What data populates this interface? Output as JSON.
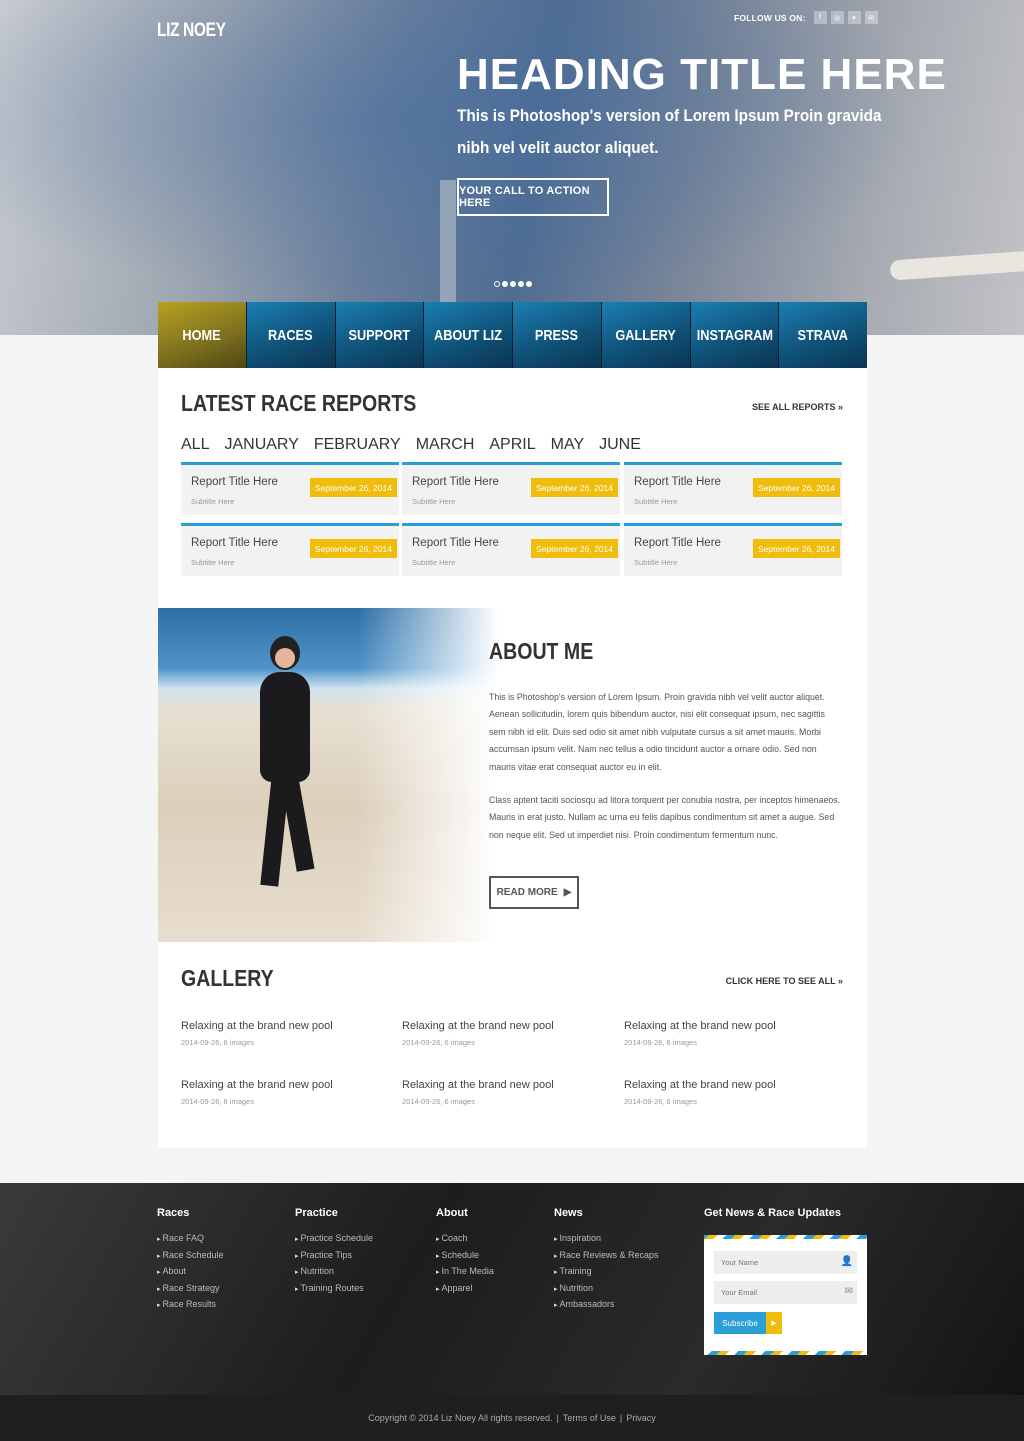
{
  "header": {
    "logo": "LIZ NOEY",
    "follow_label": "FOLLOW US ON:",
    "social": [
      {
        "icon": "facebook-icon",
        "glyph": "f"
      },
      {
        "icon": "instagram-icon",
        "glyph": "◎"
      },
      {
        "icon": "twitter-icon",
        "glyph": "▾"
      },
      {
        "icon": "email-icon",
        "glyph": "✉"
      }
    ]
  },
  "hero": {
    "title": "HEADING TITLE HERE",
    "subtitle": "This is Photoshop's version of Lorem Ipsum Proin gravida nibh vel velit auctor aliquet.",
    "cta": "YOUR CALL TO ACTION HERE",
    "slides_total": 5,
    "slide_active": 1
  },
  "nav": [
    "HOME",
    "RACES",
    "SUPPORT",
    "ABOUT LIZ",
    "PRESS",
    "GALLERY",
    "INSTAGRAM",
    "STRAVA"
  ],
  "reports": {
    "title": "LATEST RACE REPORTS",
    "see_all": "SEE ALL REPORTS »",
    "months": [
      "ALL",
      "JANUARY",
      "FEBRUARY",
      "MARCH",
      "APRIL",
      "MAY",
      "JUNE"
    ],
    "items": [
      {
        "title": "Report Title Here",
        "subtitle": "Subtitle Here",
        "date": "September 26, 2014"
      },
      {
        "title": "Report Title Here",
        "subtitle": "Subtitle Here",
        "date": "September 26, 2014"
      },
      {
        "title": "Report Title Here",
        "subtitle": "Subtitle Here",
        "date": "September 26, 2014"
      },
      {
        "title": "Report Title Here",
        "subtitle": "Subtitle Here",
        "date": "September 26, 2014"
      },
      {
        "title": "Report Title Here",
        "subtitle": "Subtitle Here",
        "date": "September 26, 2014"
      },
      {
        "title": "Report Title Here",
        "subtitle": "Subtitle Here",
        "date": "September 26, 2014"
      }
    ]
  },
  "about": {
    "title": "ABOUT ME",
    "p1": "This is Photoshop's version of Lorem Ipsum. Proin gravida nibh vel velit auctor aliquet. Aenean sollicitudin, lorem quis bibendum auctor, nisi elit consequat ipsum, nec sagittis sem nibh id elit. Duis sed odio sit amet nibh vulputate cursus a sit amet mauris. Morbi accumsan ipsum velit. Nam nec tellus a odio tincidunt auctor a ornare odio. Sed non mauris vitae erat consequat auctor eu in elit.",
    "p2": "Class aptent taciti sociosqu ad litora torquent per conubia nostra, per inceptos himenaeos. Mauris in erat justo. Nullam ac urna eu felis dapibus condimentum sit amet a augue. Sed non neque elit. Sed ut imperdiet nisi. Proin condimentum fermentum nunc.",
    "button": "READ MORE"
  },
  "gallery": {
    "title": "GALLERY",
    "see_all": "CLICK HERE TO SEE ALL »",
    "items": [
      {
        "title": "Relaxing at the brand new pool",
        "meta": "2014-09-26, 6 images"
      },
      {
        "title": "Relaxing at the brand new pool",
        "meta": "2014-09-26, 6 images"
      },
      {
        "title": "Relaxing at the brand new pool",
        "meta": "2014-09-26, 6 images"
      },
      {
        "title": "Relaxing at the brand new pool",
        "meta": "2014-09-26, 6 images"
      },
      {
        "title": "Relaxing at the brand new pool",
        "meta": "2014-09-26, 6 images"
      },
      {
        "title": "Relaxing at the brand new pool",
        "meta": "2014-09-26, 6 images"
      }
    ]
  },
  "footer": {
    "columns": [
      {
        "title": "Races",
        "links": [
          "Race FAQ",
          "Race Schedule",
          "About",
          "Race Strategy",
          "Race Results"
        ]
      },
      {
        "title": "Practice",
        "links": [
          "Practice Schedule",
          "Practice Tips",
          "Nutrition",
          "Training Routes"
        ]
      },
      {
        "title": "About",
        "links": [
          "Coach",
          "Schedule",
          "In The Media",
          "Apparel"
        ]
      },
      {
        "title": "News",
        "links": [
          "Inspiration",
          "Race Reviews & Recaps",
          "Training",
          "Nutrition",
          "Ambassadors"
        ]
      }
    ],
    "newsletter": {
      "title": "Get News & Race Updates",
      "name_placeholder": "Your Name",
      "email_placeholder": "Your Email",
      "subscribe": "Subscribe"
    },
    "copyright": "Copyright © 2014 Liz Noey All rights reserved.",
    "terms": "Terms of Use",
    "privacy": "Privacy"
  },
  "colors": {
    "accent_blue": "#2a9fd6",
    "accent_yellow": "#f0bd0d",
    "nav_active": "#9c8c1c"
  }
}
